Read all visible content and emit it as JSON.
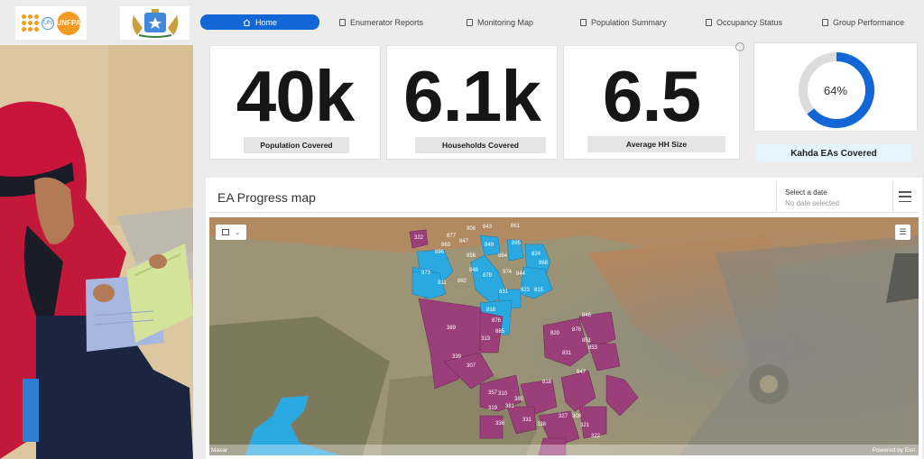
{
  "nav": {
    "items": [
      {
        "label": "Home",
        "active": true
      },
      {
        "label": "Enumerator Reports"
      },
      {
        "label": "Monitoring Map"
      },
      {
        "label": "Population Summary"
      },
      {
        "label": "Occupancy Status"
      },
      {
        "label": "Group Performance"
      }
    ],
    "active_color": "#1366d6"
  },
  "logos": {
    "unfpa_text": "UNFPA"
  },
  "indicators": {
    "population": {
      "value": "40k",
      "label": "Population Covered"
    },
    "households": {
      "value": "6.1k",
      "label": "Households Covered"
    },
    "avg_hh": {
      "value": "6.5",
      "label": "Average HH Size"
    },
    "ea_gauge": {
      "value": "64%",
      "fraction": 0.64,
      "label": "Kahda EAs Covered",
      "color": "#1366d6",
      "track_color": "#dcdcdc"
    }
  },
  "map": {
    "title": "EA Progress map",
    "date_label": "Select a date",
    "date_value": "No date selected",
    "attribution_left": "Maxar",
    "attribution_right": "Powered by Esri",
    "completed_color": "#2aa8e0",
    "in_progress_color": "#9b3f7a",
    "blue_labels": [
      "877",
      "906",
      "843",
      "861",
      "863",
      "847",
      "896",
      "856",
      "849",
      "864",
      "895",
      "824",
      "968",
      "973",
      "811",
      "882",
      "846",
      "878",
      "974",
      "844",
      "831",
      "823",
      "815",
      "818",
      "876",
      "885"
    ],
    "purple_labels": [
      "322",
      "846",
      "389",
      "313",
      "339",
      "307",
      "820",
      "876",
      "851",
      "853",
      "847",
      "831",
      "380",
      "310",
      "357",
      "381",
      "319",
      "331",
      "338",
      "336",
      "818",
      "327",
      "308",
      "321",
      "322"
    ]
  }
}
